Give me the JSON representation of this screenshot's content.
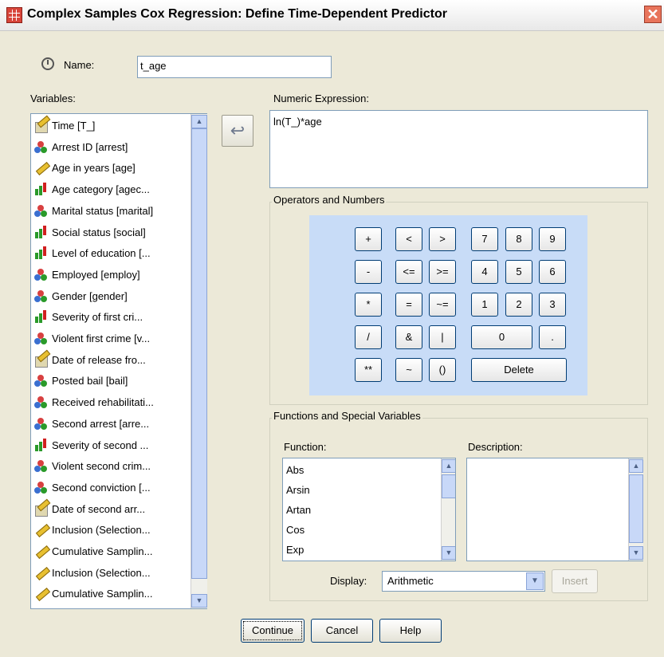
{
  "window": {
    "title": "Complex Samples Cox Regression: Define Time-Dependent Predictor",
    "close_glyph": "✕"
  },
  "name_field": {
    "label": "Name:",
    "value": "t_age"
  },
  "variables": {
    "label": "Variables:",
    "items": [
      {
        "label": "Time [T_]",
        "icon": "scale-date-icon"
      },
      {
        "label": "Arrest ID [arrest]",
        "icon": "nominal-icon"
      },
      {
        "label": "Age in years [age]",
        "icon": "scale-icon"
      },
      {
        "label": "Age category [agec...",
        "icon": "ordinal-icon"
      },
      {
        "label": "Marital status [marital]",
        "icon": "nominal-icon"
      },
      {
        "label": "Social status [social]",
        "icon": "ordinal-icon"
      },
      {
        "label": "Level of education [...",
        "icon": "ordinal-icon"
      },
      {
        "label": "Employed [employ]",
        "icon": "nominal-icon"
      },
      {
        "label": "Gender [gender]",
        "icon": "nominal-icon"
      },
      {
        "label": "Severity of first cri...",
        "icon": "ordinal-icon"
      },
      {
        "label": "Violent first crime [v...",
        "icon": "nominal-icon"
      },
      {
        "label": "Date of release fro...",
        "icon": "date-icon"
      },
      {
        "label": "Posted bail [bail]",
        "icon": "nominal-icon"
      },
      {
        "label": "Received rehabilitati...",
        "icon": "nominal-icon"
      },
      {
        "label": "Second arrest [arre...",
        "icon": "nominal-icon"
      },
      {
        "label": "Severity of second ...",
        "icon": "ordinal-icon"
      },
      {
        "label": "Violent second crim...",
        "icon": "nominal-icon"
      },
      {
        "label": "Second conviction [...",
        "icon": "nominal-icon"
      },
      {
        "label": "Date of second arr...",
        "icon": "date-icon"
      },
      {
        "label": "Inclusion (Selection...",
        "icon": "scale-icon"
      },
      {
        "label": "Cumulative Samplin...",
        "icon": "scale-icon"
      },
      {
        "label": "Inclusion (Selection...",
        "icon": "scale-icon"
      },
      {
        "label": "Cumulative Samplin...",
        "icon": "scale-icon"
      }
    ]
  },
  "expression": {
    "label": "Numeric Expression:",
    "value": "ln(T_)*age"
  },
  "operators": {
    "label": "Operators and Numbers",
    "keys": [
      "+",
      "<",
      ">",
      "7",
      "8",
      "9",
      "-",
      "<=",
      ">=",
      "4",
      "5",
      "6",
      "*",
      "=",
      "~=",
      "1",
      "2",
      "3",
      "/",
      "&",
      "|",
      "0",
      ".",
      "**",
      "~",
      "()",
      "Delete"
    ]
  },
  "functions": {
    "group_label": "Functions and Special Variables",
    "function_label": "Function:",
    "description_label": "Description:",
    "items": [
      "Abs",
      "Arsin",
      "Artan",
      "Cos",
      "Exp"
    ],
    "display_label": "Display:",
    "display_value": "Arithmetic",
    "insert_label": "Insert"
  },
  "buttons": {
    "continue": "Continue",
    "cancel": "Cancel",
    "help": "Help"
  }
}
